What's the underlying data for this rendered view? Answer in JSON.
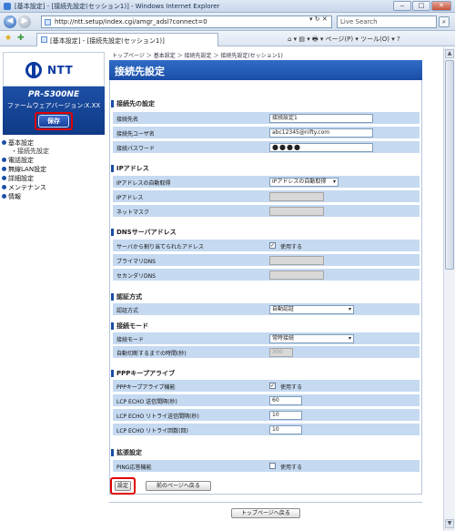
{
  "window": {
    "title": "[基本設定] - [接続先設定(セッション1)] - Windows Internet Explorer",
    "min": "‒",
    "max": "□",
    "close": "✕"
  },
  "browser": {
    "url": "http://ntt.setup/index.cgi/amgr_adsl?connect=0",
    "url_tools": "▾ ↻ ✕",
    "search_placeholder": "Live Search",
    "search_go": "⌕",
    "tab_title": "[基本設定] - [接続先設定(セッション1)]",
    "command_bar": "⌂ ▾  ▤ ▾  🖶 ▾  ページ(P) ▾  ツール(O) ▾  ?"
  },
  "sidebar": {
    "logo_text": "NTT",
    "product_name": "PR-S300NE",
    "firmware_version": "ファームウェアバージョン:X.XX",
    "save_label": "保存",
    "menu": [
      {
        "label": "基本設定"
      },
      {
        "label": "・接続先設定"
      },
      {
        "label": "電話設定"
      },
      {
        "label": "無線LAN設定"
      },
      {
        "label": "詳細設定"
      },
      {
        "label": "メンテナンス"
      },
      {
        "label": "情報"
      }
    ]
  },
  "main": {
    "breadcrumb": "トップページ ＞ 基本設定 ＞ 接続先設定 ＞ 接続先設定(セッション1)",
    "title": "接続先設定",
    "sections": {
      "connection": {
        "title": "接続先の設定",
        "name_label": "接続先名",
        "name_value": "接続設定1",
        "user_label": "接続先ユーザ名",
        "user_value": "abc12345@nifty.com",
        "pass_label": "接続パスワード",
        "pass_value": "●●●●"
      },
      "ip": {
        "title": "IPアドレス",
        "auto_label": "IPアドレスの自動取得",
        "auto_value": "IPアドレスの自動取得",
        "addr_label": "IPアドレス",
        "mask_label": "ネットマスク"
      },
      "dns": {
        "title": "DNSサーバアドレス",
        "assigned_label": "サーバから割り当てられたアドレス",
        "assigned_check": "✓",
        "assigned_text": "使用する",
        "primary_label": "プライマリDNS",
        "secondary_label": "セカンダリDNS"
      },
      "auth": {
        "title": "認証方式",
        "method_label": "認証方式",
        "method_value": "自動認証"
      },
      "conn_mode": {
        "title": "接続モード",
        "mode_label": "接続モード",
        "mode_value": "常時接続",
        "timeout_label": "自動切断するまでの時間(秒)",
        "timeout_value": "300"
      },
      "ppp": {
        "title": "PPPキープアライブ",
        "enable_label": "PPPキープアライブ機能",
        "enable_check": "✓",
        "enable_text": "使用する",
        "interval_label": "LCP ECHO 送信間隔(秒)",
        "interval_value": "60",
        "retry_interval_label": "LCP ECHO リトライ送信間隔(秒)",
        "retry_interval_value": "10",
        "retry_count_label": "LCP ECHO リトライ回数(回)",
        "retry_count_value": "10"
      },
      "ext": {
        "title": "拡張設定",
        "ping_label": "PING応答機能",
        "ping_check": "",
        "ping_text": "使用する"
      }
    },
    "buttons": {
      "set": "設定",
      "back": "前のページへ戻る",
      "top": "トップページへ戻る"
    }
  },
  "colors": {
    "accent": "#1b4ea6",
    "row_bg": "#c5d9f1",
    "highlight": "#e00000"
  }
}
